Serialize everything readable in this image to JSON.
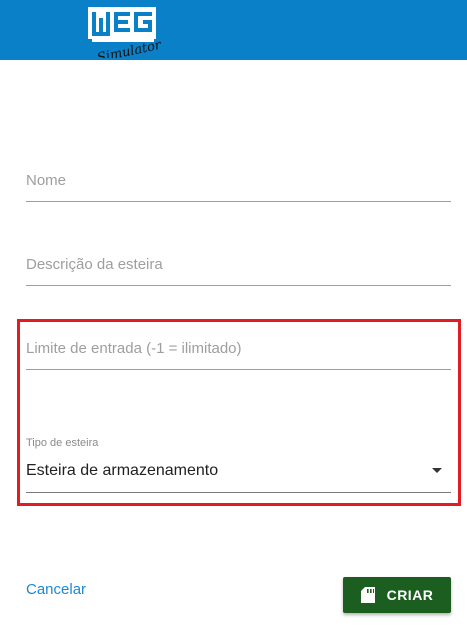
{
  "header": {
    "logo_text": "WEG",
    "logo_script": "Simulator",
    "background_color": "#0a80c9"
  },
  "form": {
    "name_placeholder": "Nome",
    "description_placeholder": "Descrição da esteira",
    "input_limit_placeholder": "Limite de entrada (-1 = ilimitado)",
    "type": {
      "label": "Tipo de esteira",
      "selected_value": "Esteira de armazenamento"
    }
  },
  "actions": {
    "cancel_label": "Cancelar",
    "create_label": "CRIAR",
    "create_icon": "sd-card-icon",
    "create_color": "#1b5e20"
  },
  "highlight_color": "#e31b23"
}
